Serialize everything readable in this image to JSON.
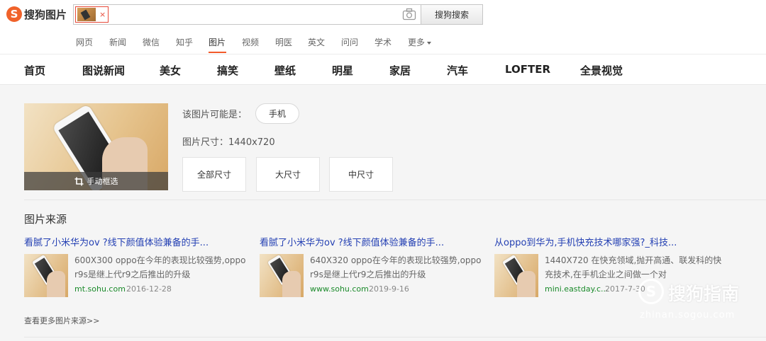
{
  "header": {
    "logo_mark": "S",
    "logo_text": "搜狗图片",
    "chip_close": "×",
    "search_button": "搜狗搜索"
  },
  "categories": [
    "网页",
    "新闻",
    "微信",
    "知乎",
    "图片",
    "视频",
    "明医",
    "英文",
    "问问",
    "学术",
    "更多"
  ],
  "main_nav": [
    "首页",
    "图说新闻",
    "美女",
    "搞笑",
    "壁纸",
    "明星",
    "家居",
    "汽车",
    "LOFTER",
    "全景视觉"
  ],
  "preview": {
    "crop_label": "手动框选"
  },
  "guess": {
    "label": "该图片可能是：",
    "tag": "手机"
  },
  "size_info": "图片尺寸：1440x720",
  "size_buttons": [
    "全部尺寸",
    "大尺寸",
    "中尺寸"
  ],
  "source": {
    "title": "图片来源",
    "items": [
      {
        "title": "看腻了小米华为ov ?线下颜值体验兼备的手...",
        "desc": "600X300 oppo在今年的表现比较强势,oppo r9s是继上代r9之后推出的升级",
        "site": "mt.sohu.com",
        "date": "2016-12-28"
      },
      {
        "title": "看腻了小米华为ov ?线下颜值体验兼备的手...",
        "desc": "640X320 oppo在今年的表现比较强势,oppo r9s是继上代r9之后推出的升级",
        "site": "www.sohu.com",
        "date": "2019-9-16"
      },
      {
        "title": "从oppo到华为,手机快充技术哪家强?_科技...",
        "desc": "1440X720 在快充领域,抛开高通、联发科的快充技术,在手机企业之间做一个对",
        "site": "mini.eastday.c...",
        "date": "2017-7-30"
      }
    ],
    "more": "查看更多图片来源>>"
  },
  "watermark": {
    "mark": "S",
    "text": "搜狗指南",
    "url": "zhinan.sogou.com"
  }
}
